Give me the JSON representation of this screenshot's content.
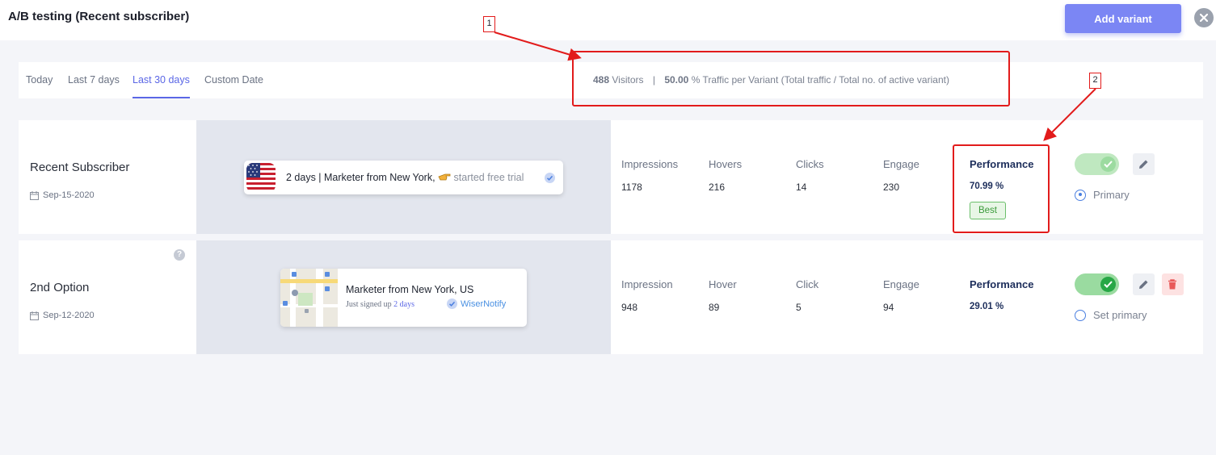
{
  "header": {
    "title": "A/B testing (Recent subscriber)",
    "add_variant_label": "Add variant"
  },
  "tabs": {
    "items": [
      {
        "label": "Today"
      },
      {
        "label": "Last 7 days"
      },
      {
        "label": "Last 30 days",
        "active": true
      },
      {
        "label": "Custom Date"
      }
    ]
  },
  "traffic": {
    "visitors": "488",
    "visitors_label": "Visitors",
    "separator": "|",
    "percent": "50.00",
    "percent_label": "% Traffic per Variant (Total traffic / Total no. of active variant)"
  },
  "variants": [
    {
      "name": "Recent Subscriber",
      "date": "Sep-15-2020",
      "notification": {
        "text": "2 days | Marketer from New York,",
        "action": "started free trial"
      },
      "stats": [
        {
          "label": "Impressions",
          "value": "1178"
        },
        {
          "label": "Hovers",
          "value": "216"
        },
        {
          "label": "Clicks",
          "value": "14"
        },
        {
          "label": "Engage",
          "value": "230"
        }
      ],
      "performance_label": "Performance",
      "performance_value": "70.99 %",
      "badge": "Best",
      "toggle_on": true,
      "primary_label": "Primary",
      "is_primary": true
    },
    {
      "name": "2nd Option",
      "date": "Sep-12-2020",
      "help": "?",
      "notification": {
        "title": "Marketer from New York, US",
        "sub_text": "Just signed up",
        "sub_time": "2 days",
        "brand": "WiserNotify"
      },
      "stats": [
        {
          "label": "Impression",
          "value": "948"
        },
        {
          "label": "Hover",
          "value": "89"
        },
        {
          "label": "Click",
          "value": "5"
        },
        {
          "label": "Engage",
          "value": "94"
        }
      ],
      "performance_label": "Performance",
      "performance_value": "29.01 %",
      "toggle_on": true,
      "primary_label": "Set primary",
      "is_primary": false
    }
  ],
  "annotations": [
    {
      "label": "1"
    },
    {
      "label": "2"
    }
  ],
  "colors": {
    "accent": "#5b67e6",
    "button": "#7b86f4",
    "annotation": "#e21b1b",
    "success": "#27a745",
    "danger": "#e85a5a"
  },
  "icons": [
    "close-icon",
    "calendar-icon",
    "edit-icon",
    "trash-icon",
    "check-icon",
    "help-icon",
    "us-flag-icon",
    "map-icon",
    "pointing-hand-icon"
  ]
}
